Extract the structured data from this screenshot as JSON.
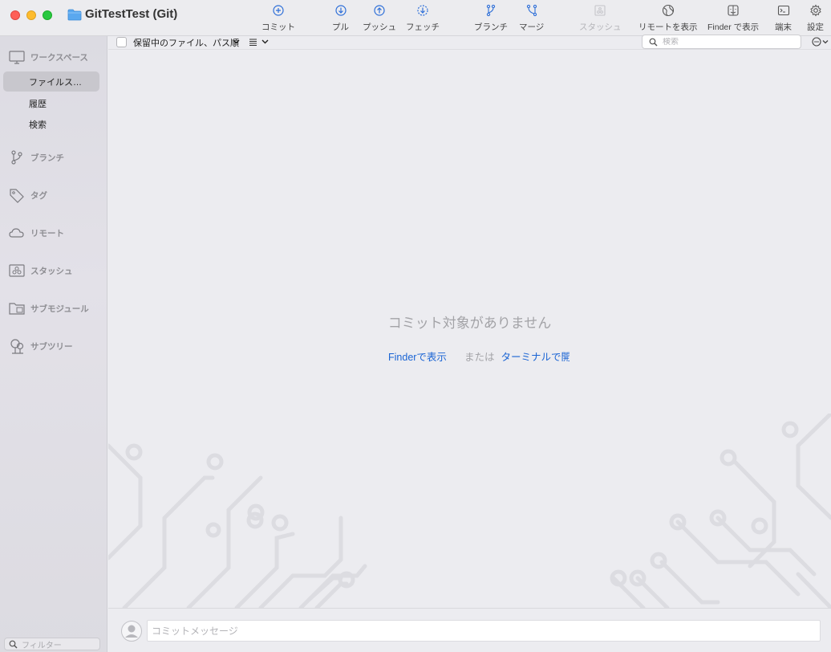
{
  "window": {
    "title": "GitTestTest (Git)"
  },
  "toolbar": {
    "commit": "コミット",
    "pull": "プル",
    "push": "プッシュ",
    "fetch": "フェッチ",
    "branch": "ブランチ",
    "merge": "マージ",
    "stash": "スタッシュ",
    "show_remote": "リモートを表示",
    "show_in_finder": "Finder で表示",
    "terminal": "端末",
    "settings": "設定"
  },
  "sidebar": {
    "workspace": "ワークスペース",
    "items": [
      "ファイルス…",
      "履歴",
      "検索"
    ],
    "branches": "ブランチ",
    "tags": "タグ",
    "remotes": "リモート",
    "stashes": "スタッシュ",
    "submodules": "サブモジュール",
    "subtrees": "サブツリー",
    "filter_placeholder": "フィルター"
  },
  "main": {
    "sort_label": "保留中のファイル、パス順",
    "search_placeholder": "検索",
    "empty_title": "コミット対象がありません",
    "finder_link": "Finderで表示",
    "or_text": "または",
    "terminal_link": "ターミナルで開く",
    "commit_placeholder": "コミットメッセージ"
  },
  "colors": {
    "accent": "#1a64d4",
    "icon_blue": "#2e6fd8"
  }
}
